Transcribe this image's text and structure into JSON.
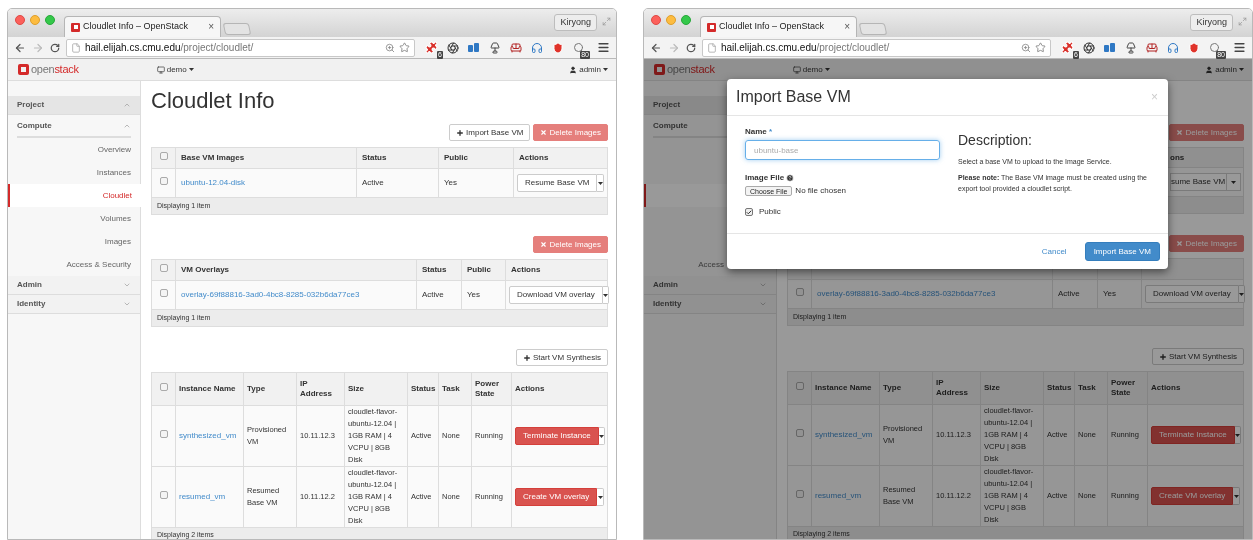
{
  "windows": [
    {
      "tab_title": "Cloudlet Info – OpenStack",
      "tab_close": "×",
      "profile": "Kiryong",
      "url_host": "hail.elijah.cs.cmu.edu",
      "url_path": "/project/cloudlet/",
      "extension_badges": [
        "6",
        "80"
      ],
      "logo": [
        "open",
        "stack"
      ],
      "project": "demo",
      "user": "admin",
      "sidebar": [
        {
          "label": "Project",
          "expanded": true,
          "groups": [
            {
              "label": "Compute",
              "expanded": true,
              "items": [
                {
                  "label": "Overview",
                  "selected": false
                },
                {
                  "label": "Instances",
                  "selected": false
                },
                {
                  "label": "Cloudlet",
                  "selected": true
                },
                {
                  "label": "Volumes",
                  "selected": false
                },
                {
                  "label": "Images",
                  "selected": false
                },
                {
                  "label": "Access & Security",
                  "selected": false
                }
              ]
            }
          ]
        },
        {
          "label": "Admin",
          "expanded": false
        },
        {
          "label": "Identity",
          "expanded": false
        }
      ],
      "title": "Cloudlet Info",
      "tables": [
        {
          "kind": "table",
          "buttons": [
            {
              "label": "Import Base VM",
              "kind": "default",
              "disabled": false
            },
            {
              "label": "Delete Images",
              "kind": "danger",
              "disabled": true
            }
          ],
          "select_all": false,
          "columns": [
            "Base VM Images",
            "Status",
            "Public",
            "Actions"
          ],
          "rows": [
            {
              "checked": false,
              "cells": [
                "ubuntu-12.04-disk",
                "Active",
                "Yes"
              ],
              "action": {
                "label": "Resume Base VM",
                "kind": "default"
              }
            }
          ],
          "footer": "Displaying 1 item"
        },
        {
          "kind": "table",
          "buttons": [
            {
              "label": "Delete Images",
              "kind": "danger",
              "disabled": true
            }
          ],
          "select_all": false,
          "columns": [
            "VM Overlays",
            "Status",
            "Public",
            "Actions"
          ],
          "rows": [
            {
              "checked": false,
              "cells": [
                "overlay-69f88816-3ad0-4bc8-8285-032b6da77ce3",
                "Active",
                "Yes"
              ],
              "action": {
                "label": "Download VM overlay",
                "kind": "default"
              }
            }
          ],
          "footer": "Displaying 1 item"
        },
        {
          "kind": "table",
          "buttons": [
            {
              "label": "Start VM Synthesis",
              "kind": "default",
              "disabled": false
            }
          ],
          "select_all": false,
          "columns": [
            "Instance Name",
            "Type",
            "IP Address",
            "Size",
            "Status",
            "Task",
            "Power State",
            "Actions"
          ],
          "rows": [
            {
              "checked": false,
              "cells": [
                "synthesized_vm",
                "Provisioned VM",
                "10.11.12.3",
                "cloudlet-flavor-ubuntu-12.04 | 1GB RAM | 4 VCPU | 8GB Disk",
                "Active",
                "None",
                "Running"
              ],
              "action": {
                "label": "Terminate Instance",
                "kind": "danger"
              }
            },
            {
              "checked": false,
              "cells": [
                "resumed_vm",
                "Resumed Base VM",
                "10.11.12.2",
                "cloudlet-flavor-ubuntu-12.04 | 1GB RAM | 4 VCPU | 8GB Disk",
                "Active",
                "None",
                "Running"
              ],
              "action": {
                "label": "Create VM overlay",
                "kind": "danger"
              }
            }
          ],
          "footer": "Displaying 2 items"
        }
      ]
    },
    {
      "tab_title": "Cloudlet Info – OpenStack",
      "tab_close": "×",
      "profile": "Kiryong",
      "url_host": "hail.elijah.cs.cmu.edu",
      "url_path": "/project/cloudlet/",
      "extension_badges": [
        "6",
        "80"
      ],
      "logo": [
        "open",
        "stack"
      ],
      "project": "demo",
      "user": "admin",
      "sidebar": [
        {
          "label": "Project",
          "groups": [
            {
              "label": "Compute",
              "items": [
                {
                  "selected": false
                },
                {
                  "selected": false
                },
                {
                  "selected": true
                },
                {
                  "selected": false
                },
                {
                  "selected": false
                },
                {
                  "label": "Access",
                  "selected": false
                }
              ]
            }
          ]
        },
        {
          "label": "Admin",
          "expanded": false
        },
        {
          "label": "Identity",
          "expanded": false
        }
      ],
      "tables": [
        {
          "kind": "covered",
          "buttons": [
            {
              "label": "Delete Images",
              "kind": "danger",
              "disabled": true
            }
          ],
          "header_fragment": "ons",
          "action_fragment": "sume Base VM"
        },
        {
          "kind": "table",
          "buttons": [
            {
              "label": "Delete Images",
              "kind": "danger",
              "disabled": true
            }
          ],
          "rows": [
            {
              "checked": false,
              "cells": [
                "overlay-69f88816-3ad0-4bc8-8285-032b6da77ce3",
                "Active",
                "Yes"
              ],
              "action": {
                "label": "Download VM overlay",
                "kind": "default"
              }
            }
          ],
          "footer": "Displaying 1 item"
        },
        {
          "kind": "table",
          "buttons": [
            {
              "label": "Start VM Synthesis",
              "kind": "default",
              "disabled": false
            }
          ],
          "select_all": false,
          "columns": [
            "Instance Name",
            "Type",
            "IP Address",
            "Size",
            "Status",
            "Task",
            "Power State",
            "Actions"
          ],
          "rows": [
            {
              "checked": false,
              "cells": [
                "synthesized_vm",
                "Provisioned VM",
                "10.11.12.3",
                "cloudlet-flavor-ubuntu-12.04 | 1GB RAM | 4 VCPU | 8GB Disk",
                "Active",
                "None",
                "Running"
              ],
              "action": {
                "label": "Terminate Instance",
                "kind": "danger"
              }
            },
            {
              "checked": false,
              "cells": [
                "resumed_vm",
                "Resumed Base VM",
                "10.11.12.2",
                "cloudlet-flavor-ubuntu-12.04 | 1GB RAM | 4 VCPU | 8GB Disk",
                "Active",
                "None",
                "Running"
              ],
              "action": {
                "label": "Create VM overlay",
                "kind": "danger"
              }
            }
          ],
          "footer": "Displaying 2 items"
        }
      ],
      "modal": {
        "title": "Import Base VM",
        "close": "×",
        "name_label": "Name",
        "required_mark": "*",
        "name_placeholder": "ubuntu-base",
        "name_focused": true,
        "file_label": "Image File",
        "choose_file": "Choose File",
        "file_status": "No file chosen",
        "public_label": "Public",
        "public_checked": true,
        "description_title": "Description:",
        "description": [
          "Select a base VM to upload to the Image Service.",
          "**Please note:** The Base VM image must be created using the export tool provided a cloudlet script."
        ],
        "cancel": "Cancel",
        "submit": "Import Base VM"
      }
    }
  ]
}
